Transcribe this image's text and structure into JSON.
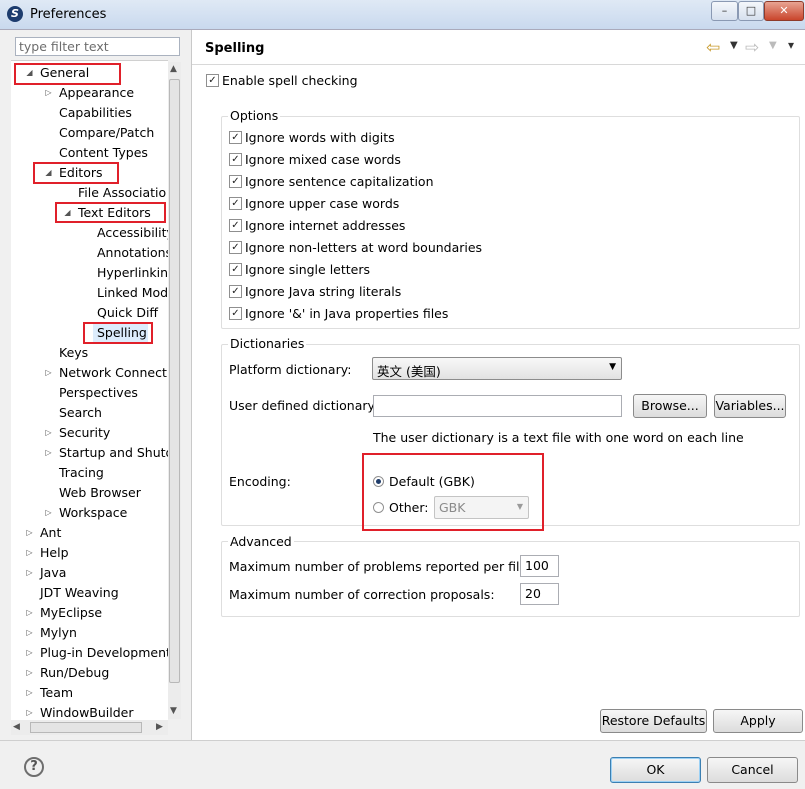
{
  "window": {
    "title": "Preferences",
    "app_icon": "eclipse-icon",
    "min": "–",
    "max": "□",
    "close": "✕"
  },
  "filter": {
    "placeholder": "type filter text"
  },
  "tree": [
    "General",
    "Appearance",
    "Capabilities",
    "Compare/Patch",
    "Content Types",
    "Editors",
    "File Associatio",
    "Text Editors",
    "Accessibility",
    "Annotations",
    "Hyperlinking",
    "Linked Mod",
    "Quick Diff",
    "Spelling",
    "Keys",
    "Network Connectio",
    "Perspectives",
    "Search",
    "Security",
    "Startup and Shutd",
    "Tracing",
    "Web Browser",
    "Workspace",
    "Ant",
    "Help",
    "Java",
    "JDT Weaving",
    "MyEclipse",
    "Mylyn",
    "Plug-in Development",
    "Run/Debug",
    "Team",
    "WindowBuilder"
  ],
  "page": {
    "title": "Spelling",
    "nav_back": "⇦",
    "nav_fwd": "⇨",
    "menu": "▾"
  },
  "enable_spell": {
    "label": "Enable spell checking",
    "checked": true
  },
  "options": {
    "title": "Options",
    "items": [
      "Ignore words with digits",
      "Ignore mixed case words",
      "Ignore sentence capitalization",
      "Ignore upper case words",
      "Ignore internet addresses",
      "Ignore non-letters at word boundaries",
      "Ignore single letters",
      "Ignore Java string literals",
      "Ignore '&' in Java properties files"
    ]
  },
  "dictionaries": {
    "title": "Dictionaries",
    "platform_label": "Platform dictionary:",
    "platform_value": "英文 (美国)",
    "user_label": "User defined dictionary:",
    "user_value": "",
    "browse": "Browse...",
    "variables": "Variables...",
    "hint": "The user dictionary is a text file with one word on each line",
    "encoding_label": "Encoding:",
    "default_label": "Default (GBK)",
    "other_label": "Other:",
    "other_value": "GBK"
  },
  "advanced": {
    "title": "Advanced",
    "max_problems_label": "Maximum number of problems reported per file:",
    "max_problems_value": "100",
    "max_corrections_label": "Maximum number of correction proposals:",
    "max_corrections_value": "20"
  },
  "buttons": {
    "restore": "Restore Defaults",
    "apply": "Apply",
    "ok": "OK",
    "cancel": "Cancel",
    "help": "?"
  },
  "colors": {
    "highlight": "#e0202a",
    "selection": "#dcecfc"
  }
}
